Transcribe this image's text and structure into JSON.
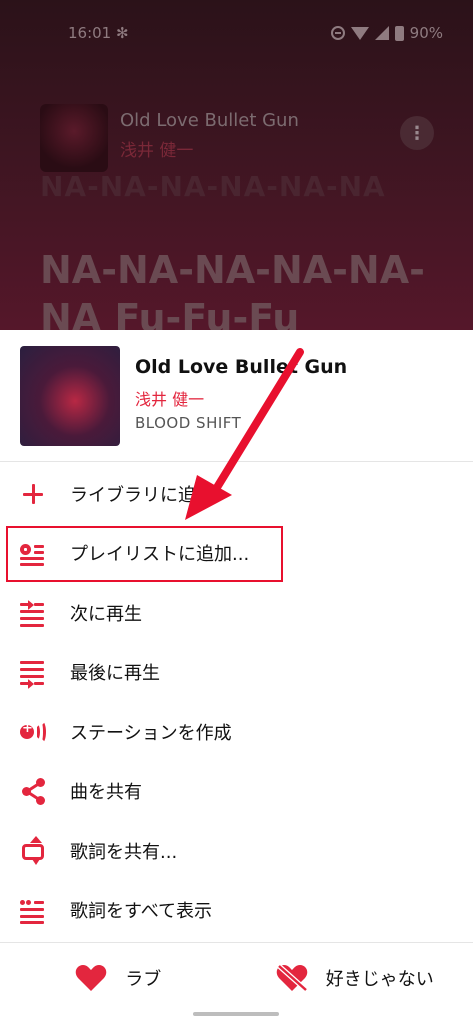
{
  "status_bar": {
    "time": "16:01",
    "fan_icon": "fan-icon",
    "battery": "90%"
  },
  "now_playing": {
    "title": "Old Love Bullet Gun",
    "artist": "浅井 健一",
    "lyric_line1": "NA-NA-NA-NA-NA-NA",
    "lyric_line2": "NA-NA-NA-NA-NA-NA Fu-Fu-Fu"
  },
  "sheet": {
    "song_title": "Old Love Bullet Gun",
    "artist": "浅井 健一",
    "album": "BLOOD SHIFT"
  },
  "menu": [
    {
      "label": "ライブラリに追加",
      "icon": "plus-icon"
    },
    {
      "label": "プレイリストに追加...",
      "icon": "playlist-add-icon"
    },
    {
      "label": "次に再生",
      "icon": "play-next-icon"
    },
    {
      "label": "最後に再生",
      "icon": "play-last-icon"
    },
    {
      "label": "ステーションを作成",
      "icon": "station-icon"
    },
    {
      "label": "曲を共有",
      "icon": "share-icon"
    },
    {
      "label": "歌詞を共有...",
      "icon": "share-lyrics-icon"
    },
    {
      "label": "歌詞をすべて表示",
      "icon": "lyrics-icon"
    }
  ],
  "bottom_bar": {
    "love_label": "ラブ",
    "dislike_label": "好きじゃない"
  },
  "colors": {
    "accent": "#e3263e",
    "annotation": "#e8102e"
  }
}
